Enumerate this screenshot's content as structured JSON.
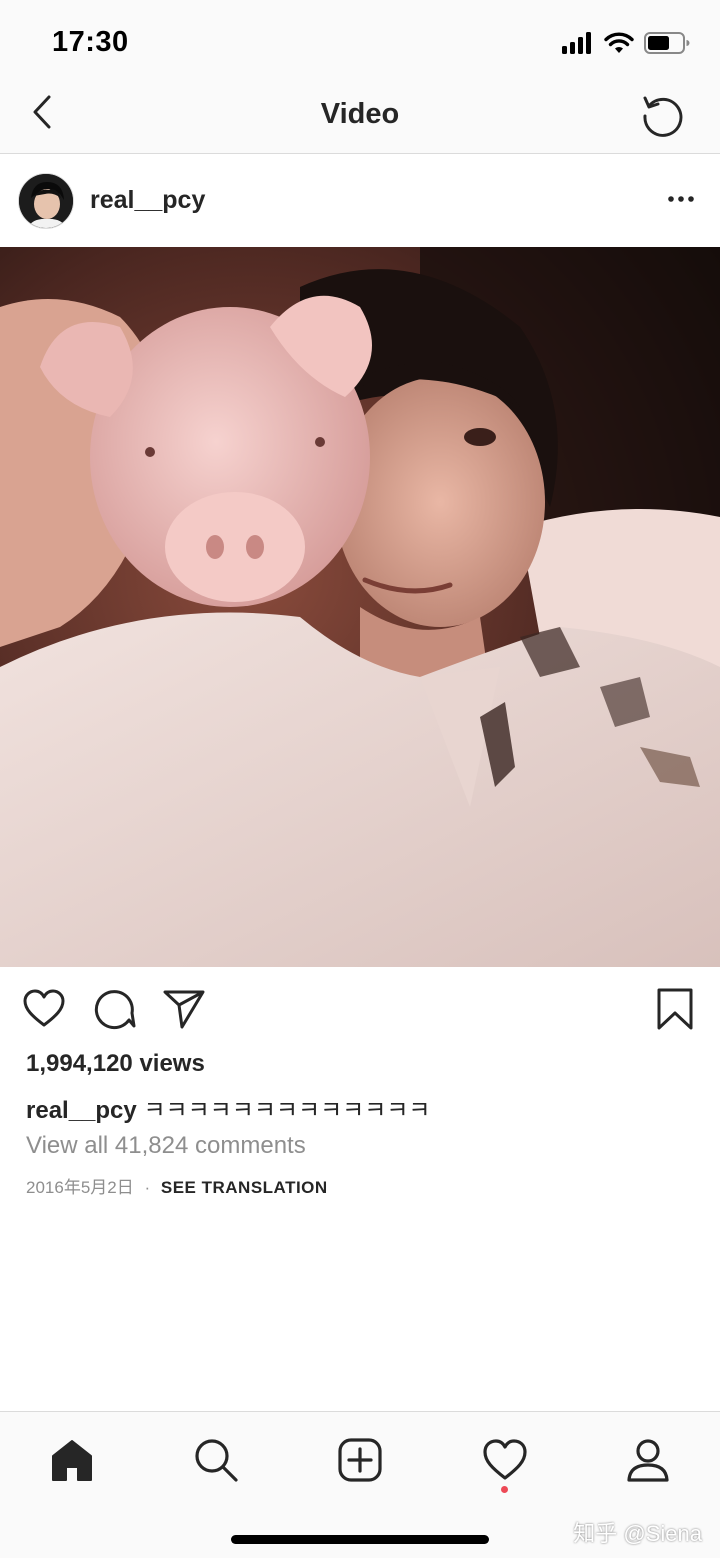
{
  "status_bar": {
    "time": "17:30",
    "icons": [
      "cellular-signal-icon",
      "wifi-icon",
      "battery-icon"
    ]
  },
  "nav": {
    "title": "Video",
    "back_icon": "chevron-left-icon",
    "refresh_icon": "refresh-icon"
  },
  "post": {
    "username": "real__pcy",
    "more_icon": "more-horizontal-icon",
    "views": "1,994,120 views",
    "caption_user": "real__pcy",
    "caption_text": "ㅋㅋㅋㅋㅋㅋㅋㅋㅋㅋㅋㅋㅋ",
    "view_comments": "View all 41,824 comments",
    "date": "2016年5月2日",
    "separator": "·",
    "see_translation": "SEE TRANSLATION",
    "action_icons": [
      "heart-icon",
      "comment-icon",
      "share-icon",
      "bookmark-icon"
    ]
  },
  "tab_bar": {
    "tabs": [
      "home-icon",
      "search-icon",
      "add-post-icon",
      "activity-heart-icon",
      "profile-icon"
    ],
    "notification_color": "#ed4956"
  },
  "watermark": "知乎 @Siena",
  "colors": {
    "text_primary": "#262626",
    "text_secondary": "#8e8e8e",
    "divider": "#dbdbdb",
    "bar_background": "#fafafa"
  }
}
